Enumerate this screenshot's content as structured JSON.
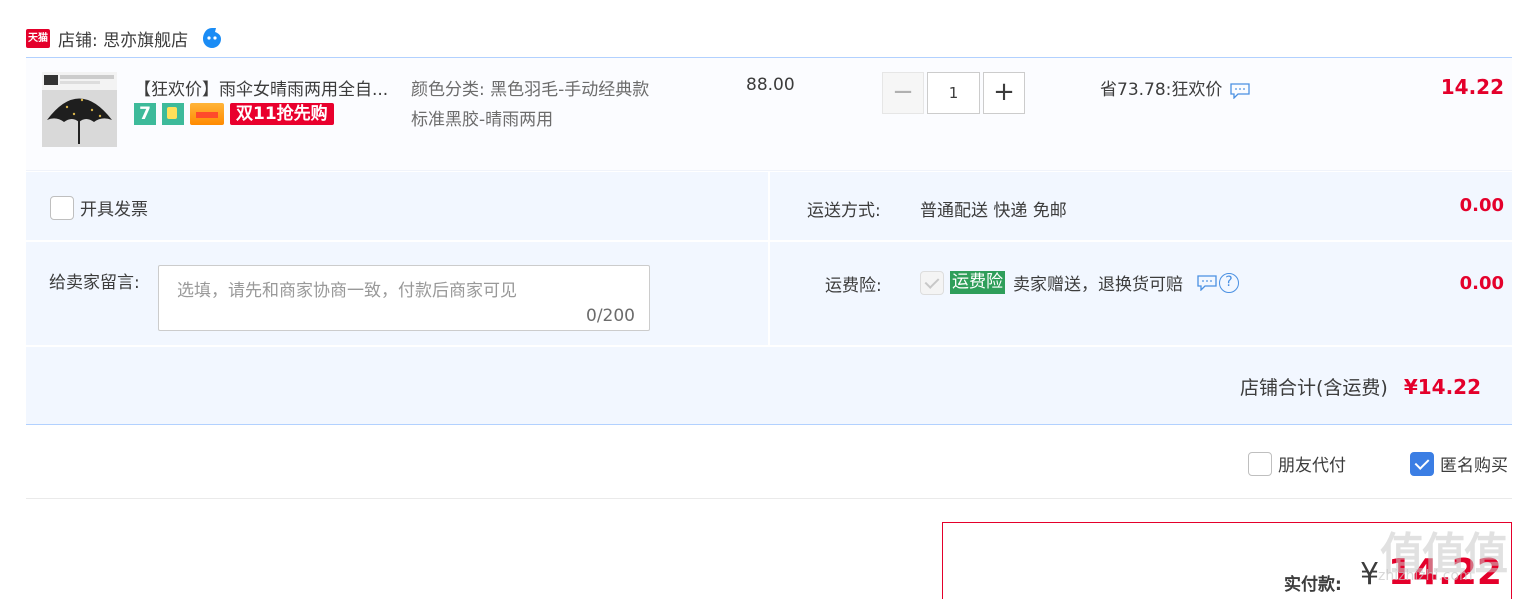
{
  "shop": {
    "tmall_badge": "天猫",
    "label": "店铺: 思亦旗舰店",
    "contact_icon": "wangwang-icon"
  },
  "item": {
    "title": "【狂欢价】雨伞女晴雨两用全自...",
    "badges": [
      "7",
      "bag",
      "card",
      "双11抢先购"
    ],
    "sku_line1": "颜色分类: 黑色羽毛-手动经典款",
    "sku_line2": "标准黑胶-晴雨两用",
    "price": "88.00",
    "qty_minus": "−",
    "quantity": "1",
    "qty_plus": "+",
    "promo": "省73.78:狂欢价",
    "subtotal": "14.22"
  },
  "options": {
    "invoice_label": "开具发票",
    "message_label": "给卖家留言:",
    "message_placeholder": "选填，请先和商家协商一致，付款后商家可见",
    "message_count": "0/200",
    "shipping_label": "运送方式:",
    "shipping_value": "普通配送 快递 免邮",
    "shipping_price": "0.00",
    "insurance_label": "运费险:",
    "insurance_badge": "运费险",
    "insurance_text": "卖家赠送，退换货可赔",
    "insurance_price": "0.00",
    "total_label": "店铺合计(含运费)",
    "total_value": "¥14.22"
  },
  "footer": {
    "friend_pay": "朋友代付",
    "anonymous_buy": "匿名购买",
    "anonymous_checked": true,
    "pay_label": "实付款:",
    "pay_currency": "¥",
    "pay_value": "14.22"
  },
  "watermark": {
    "main": "值值值",
    "sub": "zhizhizhi.com"
  },
  "colors": {
    "accent_red": "#e4002b",
    "panel_blue": "#f2f7ff",
    "line_blue": "#b2d1ff",
    "check_blue": "#3b7ee4",
    "insurance_green": "#2f9e5a"
  }
}
